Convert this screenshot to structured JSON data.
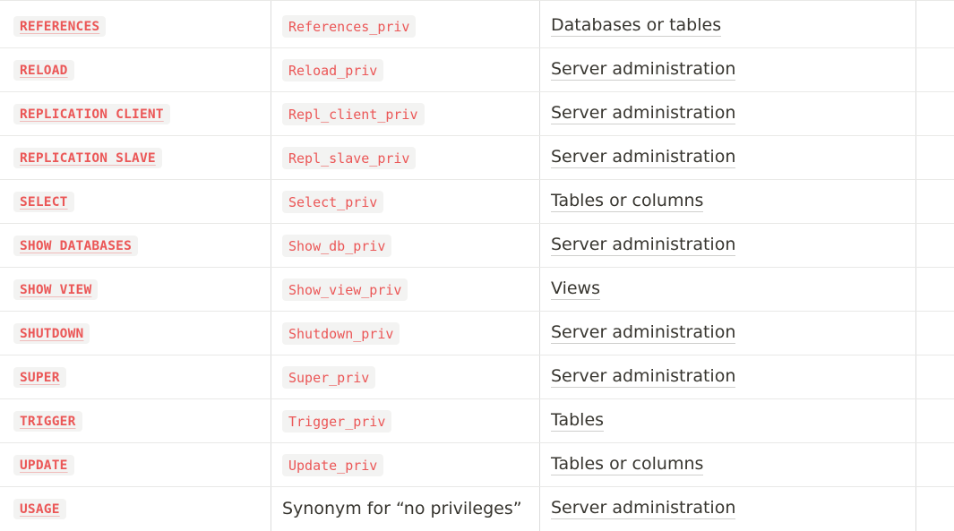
{
  "rows": [
    {
      "privilege": "REFERENCES",
      "column": "References_priv",
      "context": "Databases or tables"
    },
    {
      "privilege": "RELOAD",
      "column": "Reload_priv",
      "context": "Server administration"
    },
    {
      "privilege": "REPLICATION CLIENT",
      "column": "Repl_client_priv",
      "context": "Server administration"
    },
    {
      "privilege": "REPLICATION SLAVE",
      "column": "Repl_slave_priv",
      "context": "Server administration"
    },
    {
      "privilege": "SELECT",
      "column": "Select_priv",
      "context": "Tables or columns"
    },
    {
      "privilege": "SHOW DATABASES",
      "column": "Show_db_priv",
      "context": "Server administration"
    },
    {
      "privilege": "SHOW VIEW",
      "column": "Show_view_priv",
      "context": "Views"
    },
    {
      "privilege": "SHUTDOWN",
      "column": "Shutdown_priv",
      "context": "Server administration"
    },
    {
      "privilege": "SUPER",
      "column": "Super_priv",
      "context": "Server administration"
    },
    {
      "privilege": "TRIGGER",
      "column": "Trigger_priv",
      "context": "Tables"
    },
    {
      "privilege": "UPDATE",
      "column": "Update_priv",
      "context": "Tables or columns"
    },
    {
      "privilege": "USAGE",
      "column": "Synonym for “no privileges”",
      "context": "Server administration",
      "column_plain": true
    }
  ]
}
